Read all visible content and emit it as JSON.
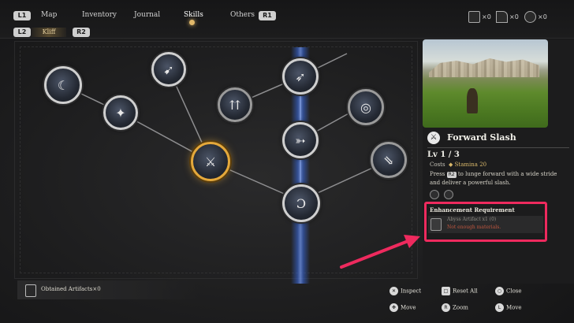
{
  "top": {
    "l1": "L1",
    "r1": "R1",
    "tabs": [
      "Map",
      "Inventory",
      "Journal",
      "Skills",
      "Others"
    ],
    "active_tab": "Skills",
    "l2": "L2",
    "r2": "R2",
    "character_tab": "Kliff",
    "counters": [
      {
        "icon": "artifact-icon",
        "value": "×0"
      },
      {
        "icon": "axe-icon",
        "value": "×0"
      },
      {
        "icon": "crest-icon",
        "value": "×0"
      }
    ]
  },
  "tree": {
    "nodes": [
      {
        "name": "skill-node-spiral",
        "glyph": "☾"
      },
      {
        "name": "skill-node-compass",
        "glyph": "✦"
      },
      {
        "name": "skill-node-fall",
        "glyph": "➹"
      },
      {
        "name": "skill-node-triple-arrow",
        "glyph": "⇈"
      },
      {
        "name": "skill-node-forward-slash",
        "glyph": "⚔"
      },
      {
        "name": "skill-node-wing",
        "glyph": "➶"
      },
      {
        "name": "skill-node-archer",
        "glyph": "➳"
      },
      {
        "name": "skill-node-swirl",
        "glyph": "◎"
      },
      {
        "name": "skill-node-arrow-rain",
        "glyph": "⇘"
      },
      {
        "name": "skill-node-bow-root",
        "glyph": "Ɔ"
      }
    ],
    "active_node": "skill-node-forward-slash"
  },
  "detail": {
    "title": "Forward Slash",
    "level": "Lv 1 / 3",
    "costs_label": "Costs",
    "stamina": "◆ Stamina 20",
    "desc_pre": "Press",
    "desc_key": "R2",
    "desc_post": "to lunge forward with a wide stride and deliver a powerful slash.",
    "enhancement_title": "Enhancement Requirement",
    "requirement": {
      "name": "Abyss Artifact  x1 (0)",
      "warning": "Not enough materials."
    }
  },
  "bottom": {
    "artifacts": "Obtained Artifacts×0",
    "hints": {
      "inspect": "Inspect",
      "reset": "Reset  All",
      "close": "Close",
      "move1": "Move",
      "zoom": "Zoom",
      "move2": "Move"
    }
  },
  "colors": {
    "highlight_box": "#ee2a5e",
    "active_node": "#e4a83b",
    "beam": "#3c6ee6"
  }
}
